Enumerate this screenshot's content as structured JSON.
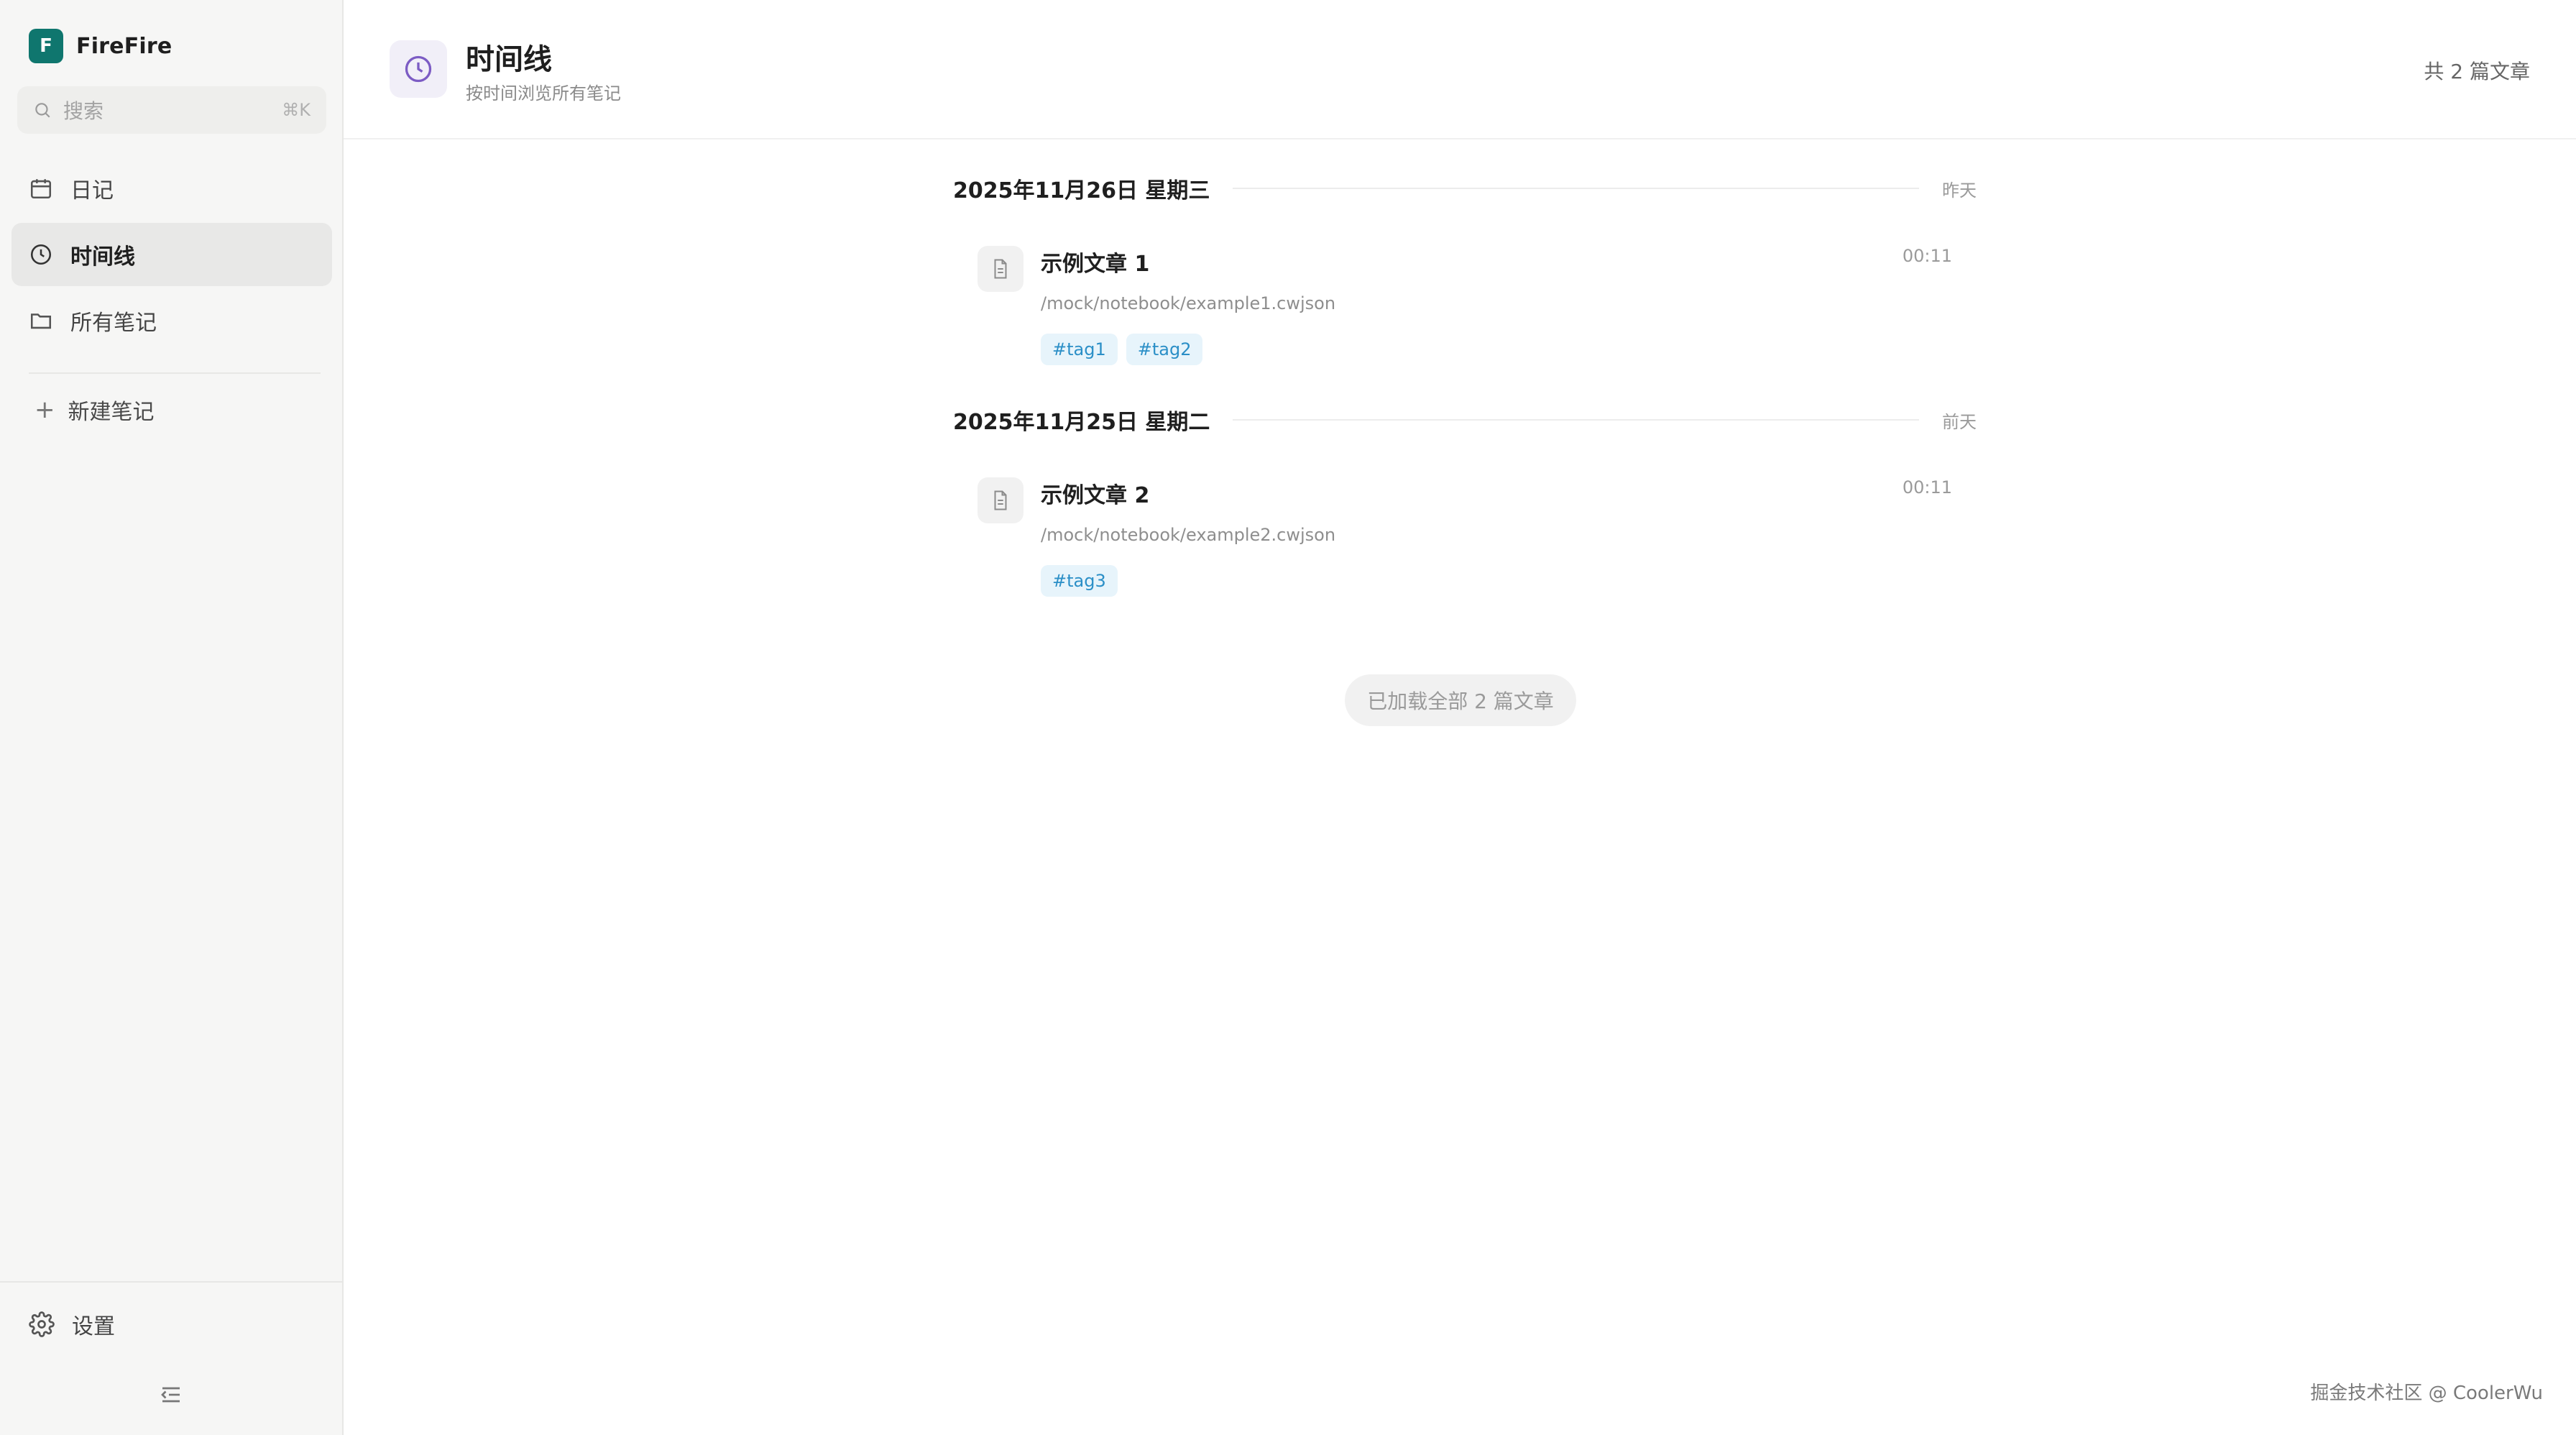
{
  "app": {
    "brand_initial": "F",
    "brand_name": "FireFire"
  },
  "sidebar": {
    "search": {
      "placeholder": "搜索",
      "shortcut": "⌘K"
    },
    "items": [
      {
        "label": "日记",
        "icon": "calendar-icon"
      },
      {
        "label": "时间线",
        "icon": "clock-icon",
        "active": true
      },
      {
        "label": "所有笔记",
        "icon": "folder-icon"
      }
    ],
    "new_note_label": "新建笔记",
    "settings_label": "设置"
  },
  "header": {
    "title": "时间线",
    "subtitle": "按时间浏览所有笔记",
    "count": "共 2 篇文章"
  },
  "timeline": {
    "groups": [
      {
        "date": "2025年11月26日 星期三",
        "relative": "昨天",
        "entries": [
          {
            "title": "示例文章 1",
            "path": "/mock/notebook/example1.cwjson",
            "time": "00:11",
            "tags": [
              "#tag1",
              "#tag2"
            ]
          }
        ]
      },
      {
        "date": "2025年11月25日 星期二",
        "relative": "前天",
        "entries": [
          {
            "title": "示例文章 2",
            "path": "/mock/notebook/example2.cwjson",
            "time": "00:11",
            "tags": [
              "#tag3"
            ]
          }
        ]
      }
    ],
    "loaded_label": "已加载全部 2 篇文章"
  },
  "watermark": "掘金技术社区 @ CoolerWu",
  "colors": {
    "accent": "#0f766e",
    "tag_bg": "#e7f4fb",
    "tag_text": "#2b8fc7"
  }
}
